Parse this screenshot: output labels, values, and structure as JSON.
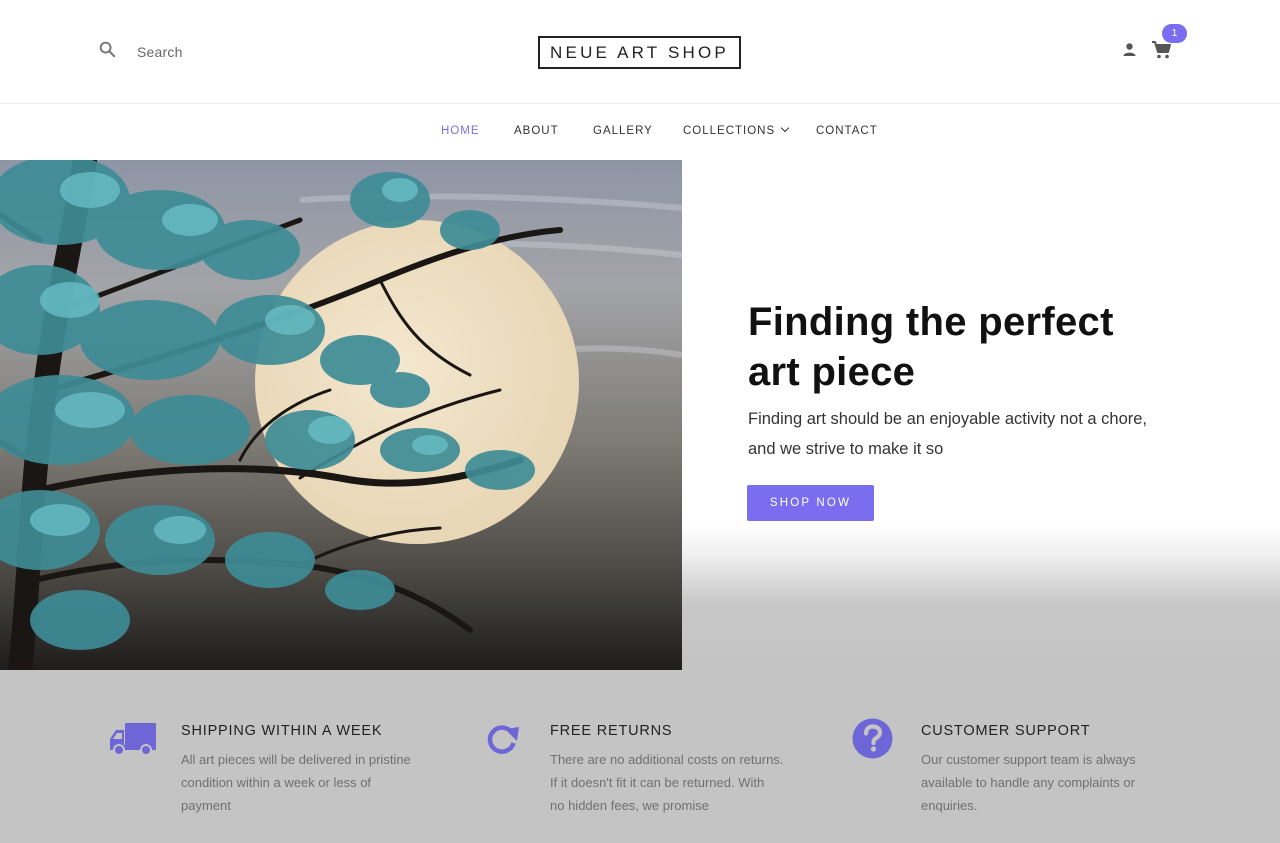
{
  "header": {
    "search_label": "Search",
    "logo": "NEUE ART SHOP",
    "cart_count": "1",
    "accent_color": "#7a6df0"
  },
  "nav": {
    "items": [
      {
        "label": "HOME",
        "active": true
      },
      {
        "label": "ABOUT"
      },
      {
        "label": "GALLERY"
      },
      {
        "label": "COLLECTIONS"
      },
      {
        "label": "CONTACT"
      }
    ]
  },
  "hero": {
    "title_line1": "Finding the perfect",
    "title_line2": "art piece",
    "subtitle_line1": "Finding art should be an enjoyable activity not a chore,",
    "subtitle_line2": "and we strive to make it so",
    "button_label": "SHOP NOW",
    "image_icon": "painting-tree-moon"
  },
  "features": [
    {
      "icon": "truck-icon",
      "title": "SHIPPING WITHIN A WEEK",
      "text_lines": [
        "All art pieces will be delivered in pristine",
        "condition within a week or less of",
        "payment"
      ]
    },
    {
      "icon": "refresh-icon",
      "title": "FREE RETURNS",
      "text_lines": [
        "There are no additional costs on returns.",
        "If it doesn't fit it can be returned. With",
        "no hidden fees, we promise"
      ]
    },
    {
      "icon": "question-icon",
      "title": "CUSTOMER SUPPORT",
      "text_lines": [
        "Our customer support team is always",
        "available to handle any complaints or",
        "enquiries."
      ]
    }
  ]
}
